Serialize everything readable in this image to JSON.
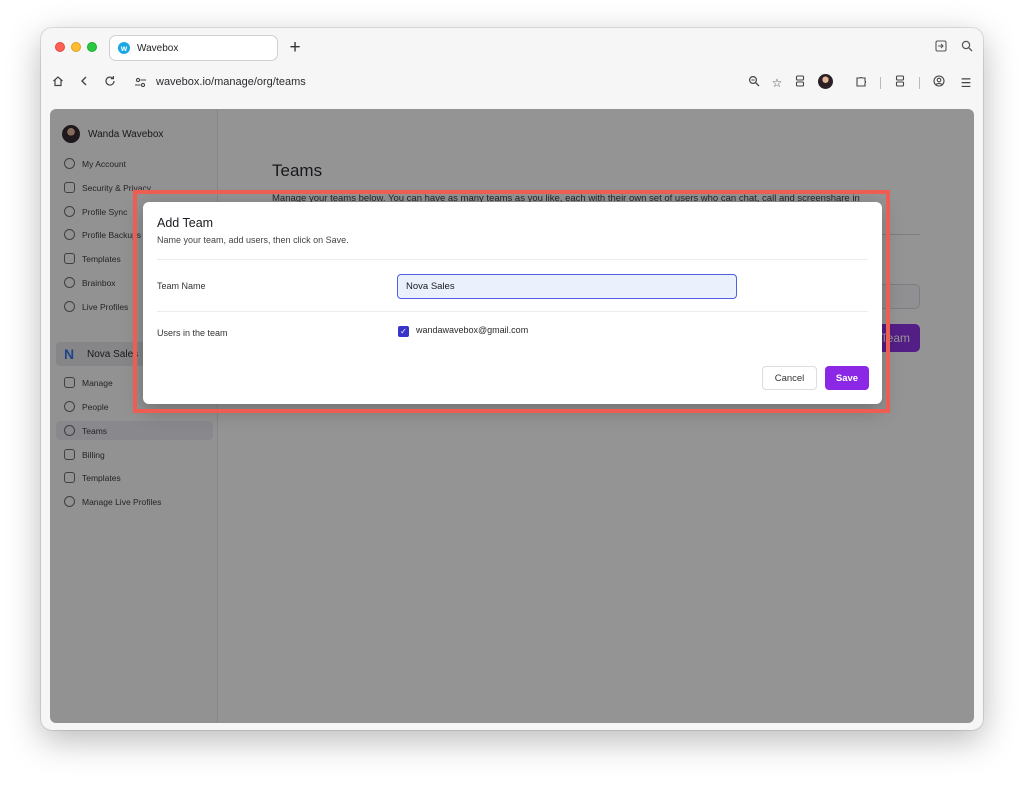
{
  "browser": {
    "tab_title": "Wavebox",
    "url": "wavebox.io/manage/org/teams"
  },
  "sidebar": {
    "user_name": "Wanda Wavebox",
    "account_items": [
      {
        "label": "My Account",
        "icon": "person-circle-icon"
      },
      {
        "label": "Security & Privacy",
        "icon": "lock-icon"
      },
      {
        "label": "Profile Sync",
        "icon": "sync-icon"
      },
      {
        "label": "Profile Backups",
        "icon": "cloud-upload-icon"
      },
      {
        "label": "Templates",
        "icon": "copy-icon"
      },
      {
        "label": "Brainbox",
        "icon": "lightbulb-icon"
      },
      {
        "label": "Live Profiles",
        "icon": "fingerprint-icon"
      }
    ],
    "org_name": "Nova Sales",
    "org_items": [
      {
        "label": "Manage",
        "icon": "id-card-icon"
      },
      {
        "label": "People",
        "icon": "add-person-icon"
      },
      {
        "label": "Teams",
        "icon": "team-icon",
        "active": true
      },
      {
        "label": "Billing",
        "icon": "credit-card-icon"
      },
      {
        "label": "Templates",
        "icon": "copy-icon"
      },
      {
        "label": "Manage Live Profiles",
        "icon": "fingerprint-icon"
      }
    ]
  },
  "main": {
    "title": "Teams",
    "description": "Manage your teams below. You can have as many teams as you like, each with their own set of users who can chat, call and screenshare in",
    "add_team_label": "Add Team"
  },
  "modal": {
    "title": "Add Team",
    "subtitle": "Name your team, add users, then click on Save.",
    "team_name_label": "Team Name",
    "team_name_value": "Nova Sales",
    "users_label": "Users in the team",
    "users": [
      {
        "email": "wandawavebox@gmail.com",
        "checked": true
      }
    ],
    "cancel_label": "Cancel",
    "save_label": "Save"
  },
  "colors": {
    "accent": "#8b28e6",
    "highlight": "#ee5d52",
    "checkbox": "#3a35c9"
  }
}
